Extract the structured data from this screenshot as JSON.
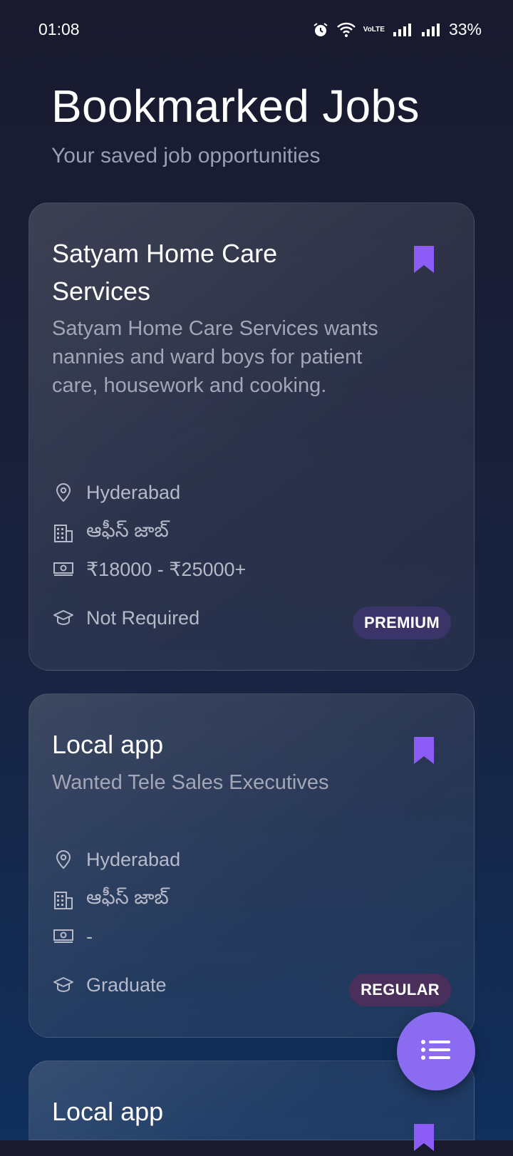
{
  "status": {
    "time": "01:08",
    "battery": "33%",
    "network_label": "VoLTE"
  },
  "header": {
    "title": "Bookmarked Jobs",
    "subtitle": "Your saved job opportunities"
  },
  "colors": {
    "accent": "#8b6cf0",
    "bookmark": "#8b5cf6",
    "premium_badge": "#3a3468",
    "regular_badge": "#4a2f5a"
  },
  "jobs": [
    {
      "title": "Satyam Home Care Services",
      "description": "Satyam Home Care Services wants nannies and ward boys for patient care, housework and cooking.",
      "location": "Hyderabad",
      "job_type": "ఆఫీస్ జాబ్",
      "salary": "₹18000 - ₹25000+",
      "education": "Not Required",
      "tier": "PREMIUM",
      "bookmarked": true
    },
    {
      "title": "Local app",
      "description": "Wanted Tele Sales Executives",
      "location": "Hyderabad",
      "job_type": "ఆఫీస్ జాబ్",
      "salary": "-",
      "education": "Graduate",
      "tier": "REGULAR",
      "bookmarked": true
    },
    {
      "title": "Local app",
      "bookmarked": true
    }
  ],
  "icons": [
    "alarm-icon",
    "wifi-icon",
    "signal-icon",
    "location-pin-icon",
    "building-icon",
    "money-icon",
    "graduation-cap-icon",
    "bookmark-icon",
    "list-icon"
  ]
}
